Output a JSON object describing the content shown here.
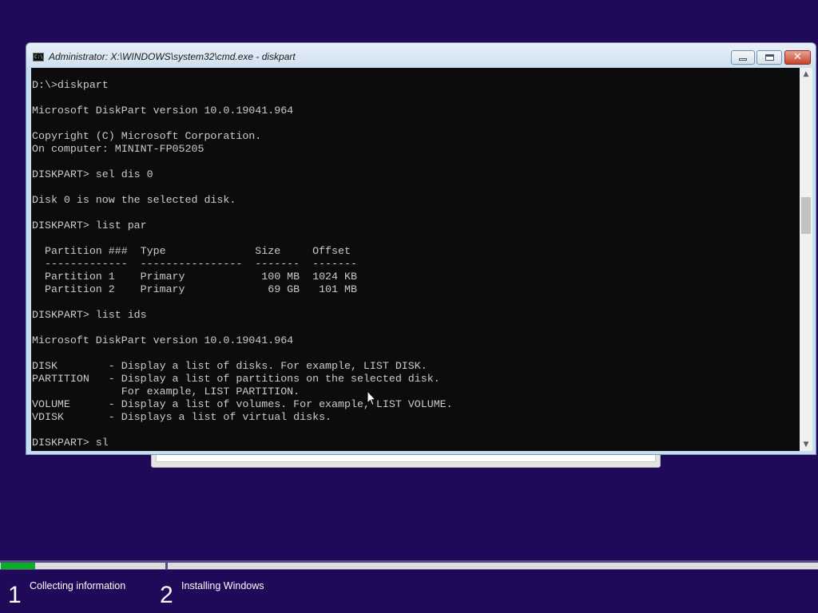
{
  "window": {
    "title": "Administrator: X:\\WINDOWS\\system32\\cmd.exe - diskpart",
    "icon_label": "C:\\",
    "close_glyph": "✕"
  },
  "console": {
    "lines": [
      "D:\\>diskpart",
      "",
      "Microsoft DiskPart version 10.0.19041.964",
      "",
      "Copyright (C) Microsoft Corporation.",
      "On computer: MININT-FP05205",
      "",
      "DISKPART> sel dis 0",
      "",
      "Disk 0 is now the selected disk.",
      "",
      "DISKPART> list par",
      "",
      "  Partition ###  Type              Size     Offset",
      "  -------------  ----------------  -------  -------",
      "  Partition 1    Primary            100 MB  1024 KB",
      "  Partition 2    Primary             69 GB   101 MB",
      "",
      "DISKPART> list ids",
      "",
      "Microsoft DiskPart version 10.0.19041.964",
      "",
      "DISK        - Display a list of disks. For example, LIST DISK.",
      "PARTITION   - Display a list of partitions on the selected disk.",
      "              For example, LIST PARTITION.",
      "VOLUME      - Display a list of volumes. For example, LIST VOLUME.",
      "VDISK       - Displays a list of virtual disks.",
      "",
      "DISKPART> sl"
    ]
  },
  "scrollbar": {
    "up_arrow": "▲",
    "down_arrow": "▼"
  },
  "setup": {
    "progress_fraction": 0.21,
    "progress_color": "#06b025",
    "background_color": "#200959",
    "steps": [
      {
        "number": "1",
        "label": "Collecting information"
      },
      {
        "number": "2",
        "label": "Installing Windows"
      }
    ]
  },
  "icons": [
    "cmd-icon",
    "minimize-icon",
    "maximize-icon",
    "close-icon",
    "mouse-pointer-icon"
  ]
}
